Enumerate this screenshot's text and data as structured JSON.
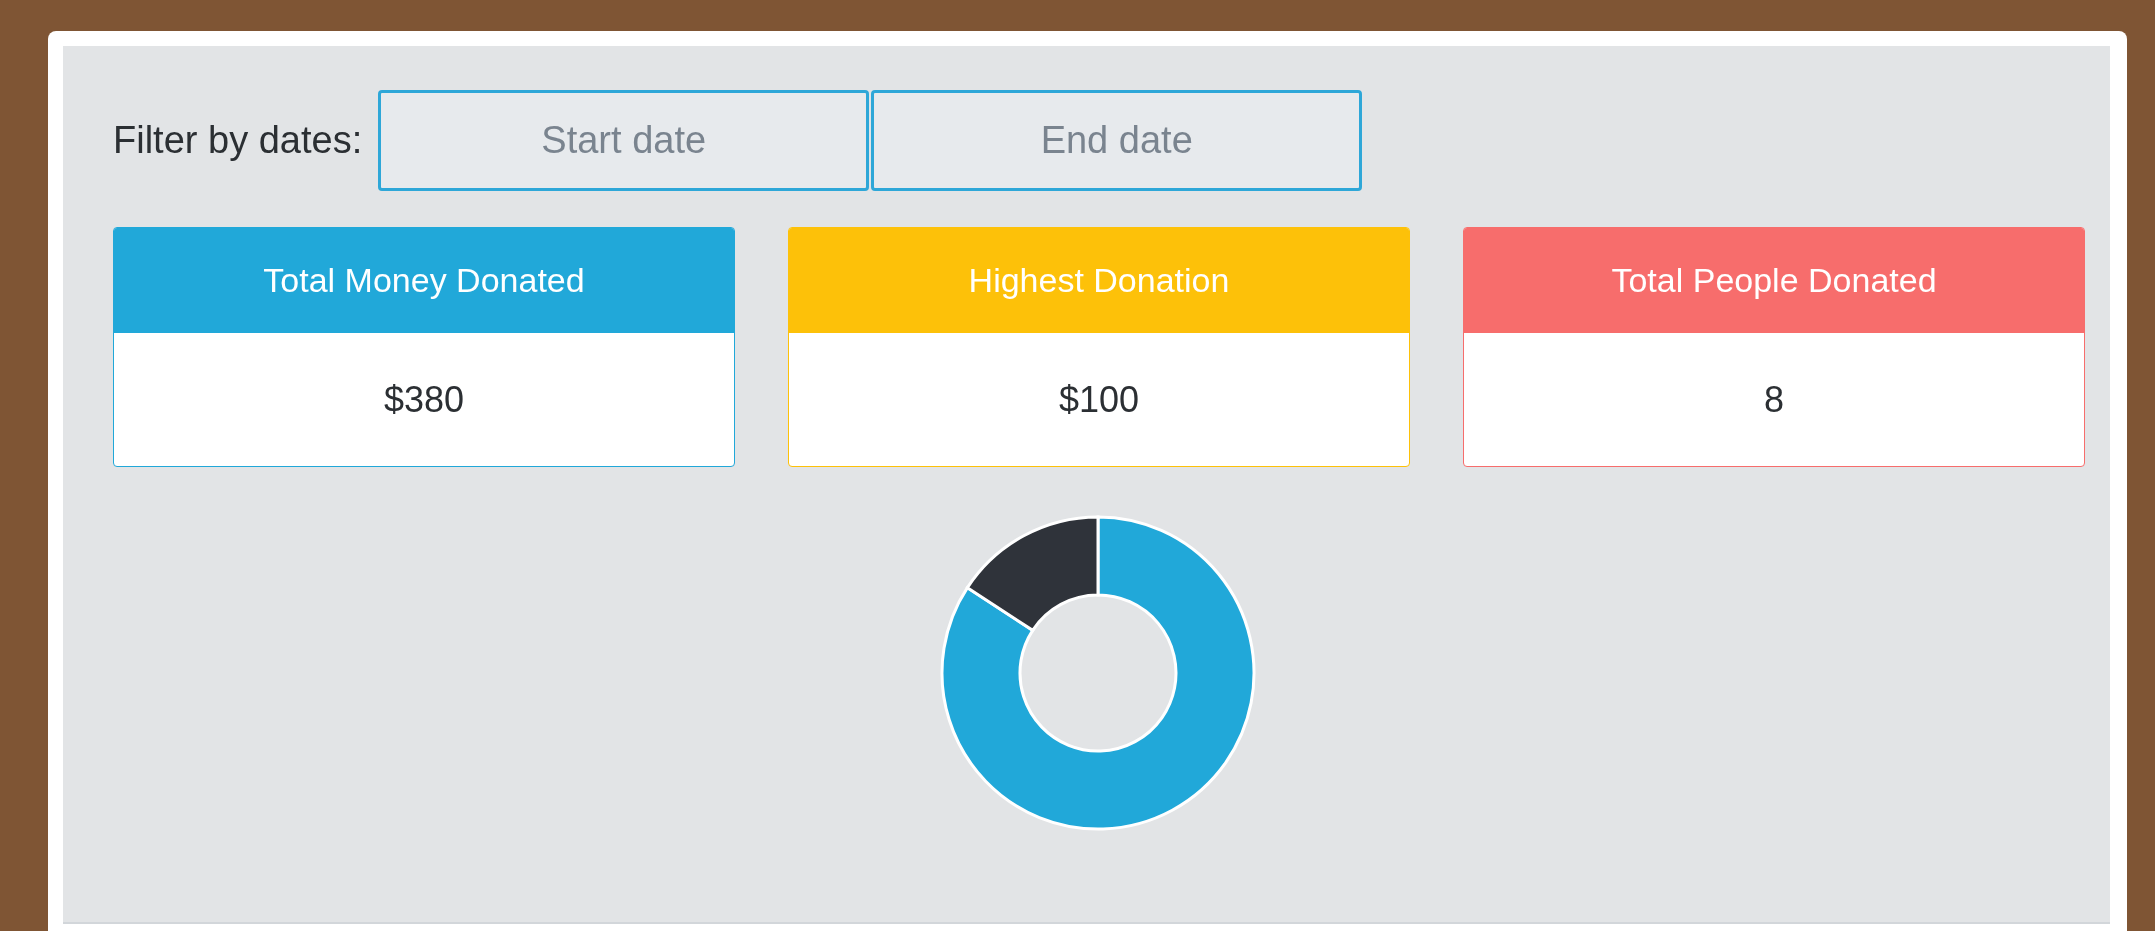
{
  "filter": {
    "label": "Filter by dates:",
    "start": {
      "placeholder": "Start date"
    },
    "end": {
      "placeholder": "End date"
    }
  },
  "cards": [
    {
      "title": "Total Money Donated",
      "value": "$380",
      "color": "#21a8d9"
    },
    {
      "title": "Highest Donation",
      "value": "$100",
      "color": "#fdc109"
    },
    {
      "title": "Total People Donated",
      "value": "8",
      "color": "#f76d6c"
    }
  ]
}
